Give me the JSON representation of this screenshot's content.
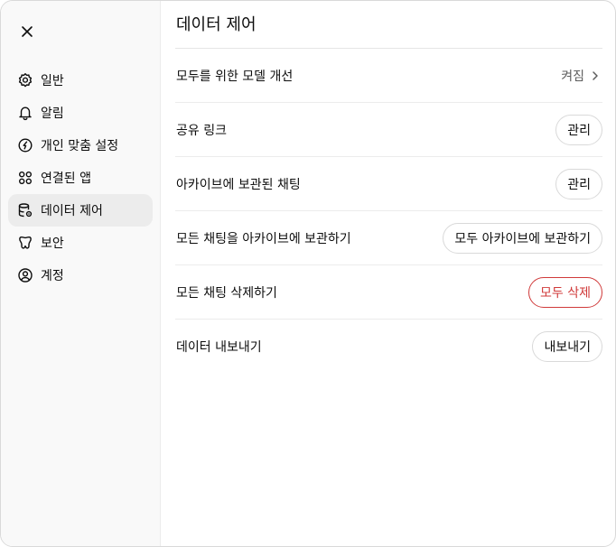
{
  "sidebar": {
    "close_icon": "x-icon",
    "items": [
      {
        "label": "일반",
        "icon": "gear-icon",
        "active": false
      },
      {
        "label": "알림",
        "icon": "bell-icon",
        "active": false
      },
      {
        "label": "개인 맞춤 설정",
        "icon": "personalization-icon",
        "active": false
      },
      {
        "label": "연결된 앱",
        "icon": "apps-icon",
        "active": false
      },
      {
        "label": "데이터 제어",
        "icon": "database-gear-icon",
        "active": true
      },
      {
        "label": "보안",
        "icon": "shield-lock-icon",
        "active": false
      },
      {
        "label": "계정",
        "icon": "user-circle-icon",
        "active": false
      }
    ]
  },
  "main": {
    "title": "데이터 제어",
    "rows": [
      {
        "label": "모두를 위한 모델 개선",
        "value": "켜짐",
        "type": "link"
      },
      {
        "label": "공유 링크",
        "button": "관리",
        "type": "button"
      },
      {
        "label": "아카이브에 보관된 채팅",
        "button": "관리",
        "type": "button"
      },
      {
        "label": "모든 채팅을 아카이브에 보관하기",
        "button": "모두 아카이브에 보관하기",
        "type": "button"
      },
      {
        "label": "모든 채팅 삭제하기",
        "button": "모두 삭제",
        "type": "danger"
      },
      {
        "label": "데이터 내보내기",
        "button": "내보내기",
        "type": "button"
      }
    ]
  },
  "colors": {
    "danger": "#d03a3a",
    "sidebar_bg": "#f9f9f9",
    "active_bg": "#ececec"
  }
}
